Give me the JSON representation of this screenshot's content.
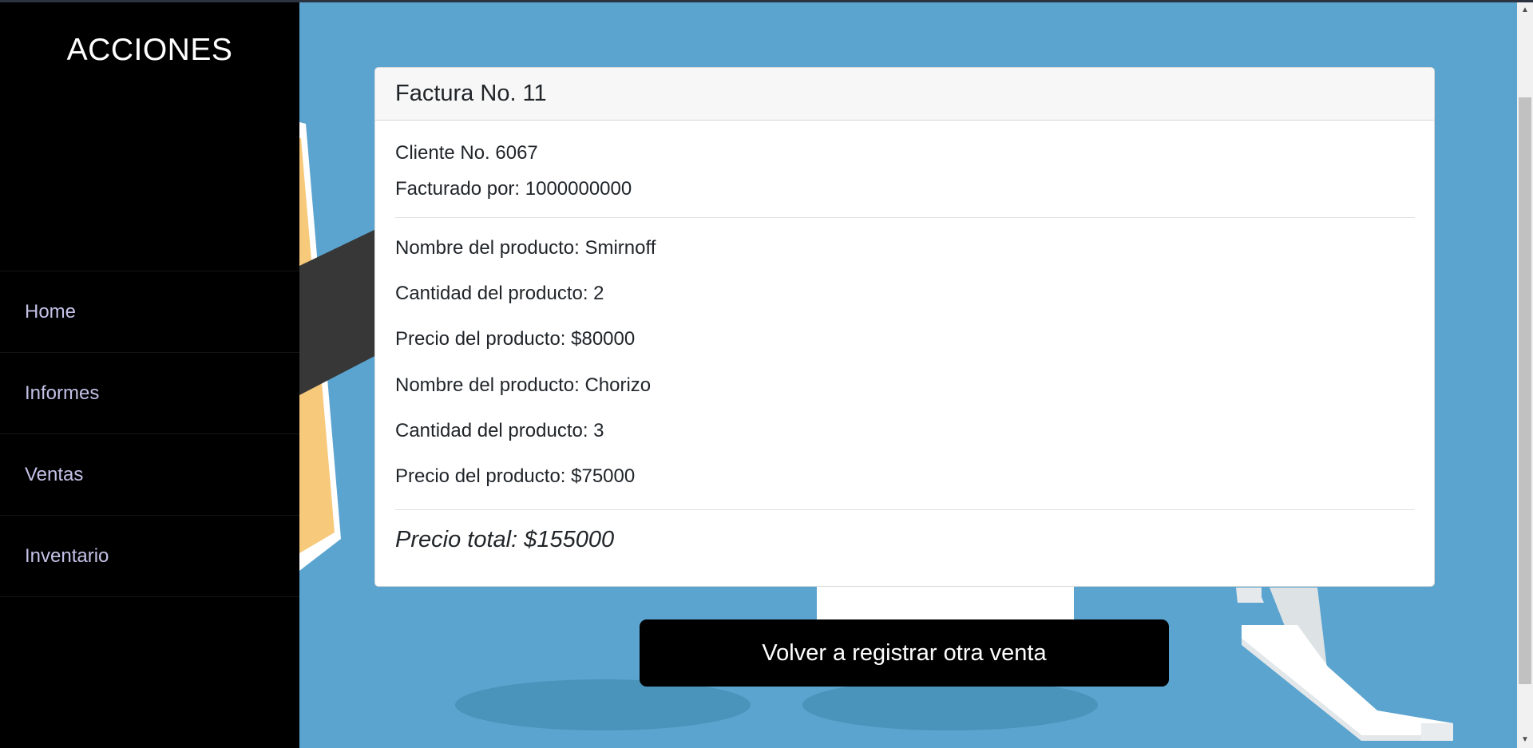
{
  "sidebar": {
    "title": "ACCIONES",
    "items": [
      {
        "label": "Home"
      },
      {
        "label": "Informes"
      },
      {
        "label": "Ventas"
      },
      {
        "label": "Inventario"
      }
    ]
  },
  "invoice": {
    "title": "Factura No. 11",
    "client": "Cliente No. 6067",
    "billed_by": "Facturado por: 1000000000",
    "products": [
      {
        "name": "Nombre del producto: Smirnoff",
        "quantity": "Cantidad del producto: 2",
        "price": "Precio del producto: $80000"
      },
      {
        "name": "Nombre del producto: Chorizo",
        "quantity": "Cantidad del producto: 3",
        "price": "Precio del producto: $75000"
      }
    ],
    "total": "Precio total: $155000"
  },
  "action": {
    "label": "Volver a registrar otra venta"
  },
  "colors": {
    "background": "#5ba4d0",
    "sidebar": "#000000",
    "nav_text": "#c3c1e6",
    "button": "#000000"
  }
}
